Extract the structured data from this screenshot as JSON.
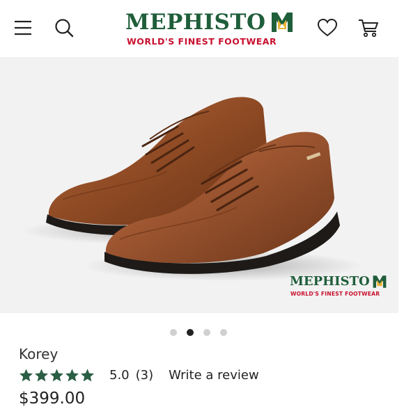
{
  "header": {
    "brand": "MEPHISTO",
    "tagline": "WORLD'S FINEST FOOTWEAR",
    "icons": [
      "menu-icon",
      "search-icon",
      "heart-icon",
      "cart-icon"
    ]
  },
  "hero": {
    "watermark_brand": "MEPHISTO",
    "watermark_tagline": "WORLD'S FINEST FOOTWEAR",
    "carousel_count": 4,
    "carousel_active": 2
  },
  "product": {
    "title": "Korey",
    "rating": "5.0",
    "rating_count": "(3)",
    "review_link": "Write a review",
    "price": "$399.00",
    "stars": 5
  },
  "colors": {
    "brand_green": "#1f5e3a",
    "brand_red": "#c8102e",
    "star_green": "#2b5f45"
  }
}
